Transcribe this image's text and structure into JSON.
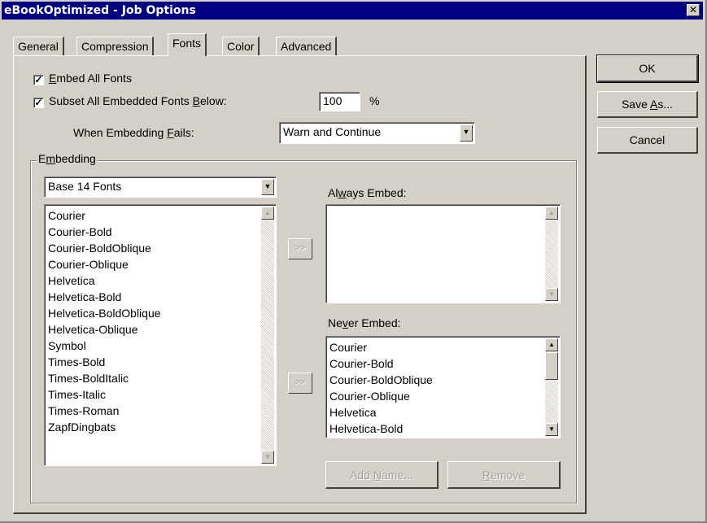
{
  "window": {
    "title": "eBookOptimized - Job Options",
    "close_glyph": "✕"
  },
  "tabs": [
    {
      "label": "General"
    },
    {
      "label": "Compression"
    },
    {
      "label": "Fonts"
    },
    {
      "label": "Color"
    },
    {
      "label": "Advanced"
    }
  ],
  "active_tab": "Fonts",
  "buttons": {
    "ok": "OK",
    "save_as_pre": "Save ",
    "save_as_ul": "A",
    "save_as_post": "s...",
    "cancel": "Cancel"
  },
  "options": {
    "embed_all": {
      "ul": "E",
      "rest": "mbed All Fonts",
      "checked": true
    },
    "subset": {
      "pre": "Subset All Embedded Fonts ",
      "ul": "B",
      "post": "elow:",
      "checked": true
    },
    "subset_value": "100",
    "subset_unit": "%",
    "when_fails": {
      "pre": "When Embedding ",
      "ul": "F",
      "post": "ails:"
    },
    "when_fails_value": "Warn and Continue"
  },
  "embedding": {
    "group_pre": "E",
    "group_ul": "m",
    "group_post": "bedding",
    "font_source": "Base 14 Fonts",
    "fonts": [
      "Courier",
      "Courier-Bold",
      "Courier-BoldOblique",
      "Courier-Oblique",
      "Helvetica",
      "Helvetica-Bold",
      "Helvetica-BoldOblique",
      "Helvetica-Oblique",
      "Symbol",
      "Times-Bold",
      "Times-BoldItalic",
      "Times-Italic",
      "Times-Roman",
      "ZapfDingbats"
    ],
    "always_label": {
      "pre": "Al",
      "ul": "w",
      "post": "ays Embed:"
    },
    "always": [],
    "never_label": {
      "pre": "Ne",
      "ul": "v",
      "post": "er Embed:"
    },
    "never": [
      "Courier",
      "Courier-Bold",
      "Courier-BoldOblique",
      "Courier-Oblique",
      "Helvetica",
      "Helvetica-Bold"
    ],
    "move_glyph": ">>",
    "add_name": {
      "pre": "Add ",
      "ul": "N",
      "post": "ame..."
    },
    "remove": {
      "ul": "R",
      "post": "emove"
    }
  }
}
